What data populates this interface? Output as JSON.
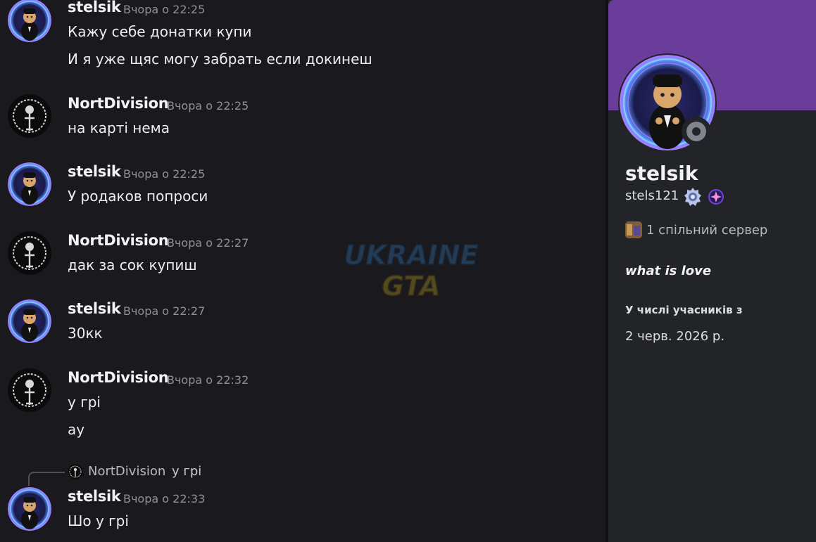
{
  "messages": [
    {
      "author": "stelsik",
      "time": "Вчора о 22:25",
      "lines": [
        "Кажу себе донатки купи",
        "И я уже щяс могу забрать если докинеш"
      ]
    },
    {
      "author": "NortDivision",
      "time": "Вчора о 22:25",
      "lines": [
        "на карті нема"
      ]
    },
    {
      "author": "stelsik",
      "time": "Вчора о 22:25",
      "lines": [
        "У родаков попроси"
      ]
    },
    {
      "author": "NortDivision",
      "time": "Вчора о 22:27",
      "lines": [
        "дак за сок купиш"
      ]
    },
    {
      "author": "stelsik",
      "time": "Вчора о 22:27",
      "lines": [
        "30кк"
      ]
    },
    {
      "author": "NortDivision",
      "time": "Вчора о 22:32",
      "lines": [
        "у грі",
        "ау"
      ]
    },
    {
      "author": "stelsik",
      "time": "Вчора о 22:33",
      "lines": [
        "Шо у грі"
      ]
    }
  ],
  "reply": {
    "author": "NortDivision",
    "text": "у грі"
  },
  "watermark": {
    "line1": "UKRAINE",
    "line2": "GTA"
  },
  "profile": {
    "display_name": "stelsik",
    "username": "stels121",
    "mutual_servers": "1 спільний сервер",
    "about": "what is love",
    "member_since_label": "У числі учасників з",
    "member_since": "2 черв. 2026 р.",
    "status": "offline",
    "badges": [
      "nitro-badge-icon",
      "server-boost-badge-icon"
    ]
  },
  "colors": {
    "background": "#1a1a1e",
    "panel": "#232428",
    "banner": "#6a3d9a",
    "timestamp": "#8d9199",
    "status_offline": "#80848e"
  }
}
